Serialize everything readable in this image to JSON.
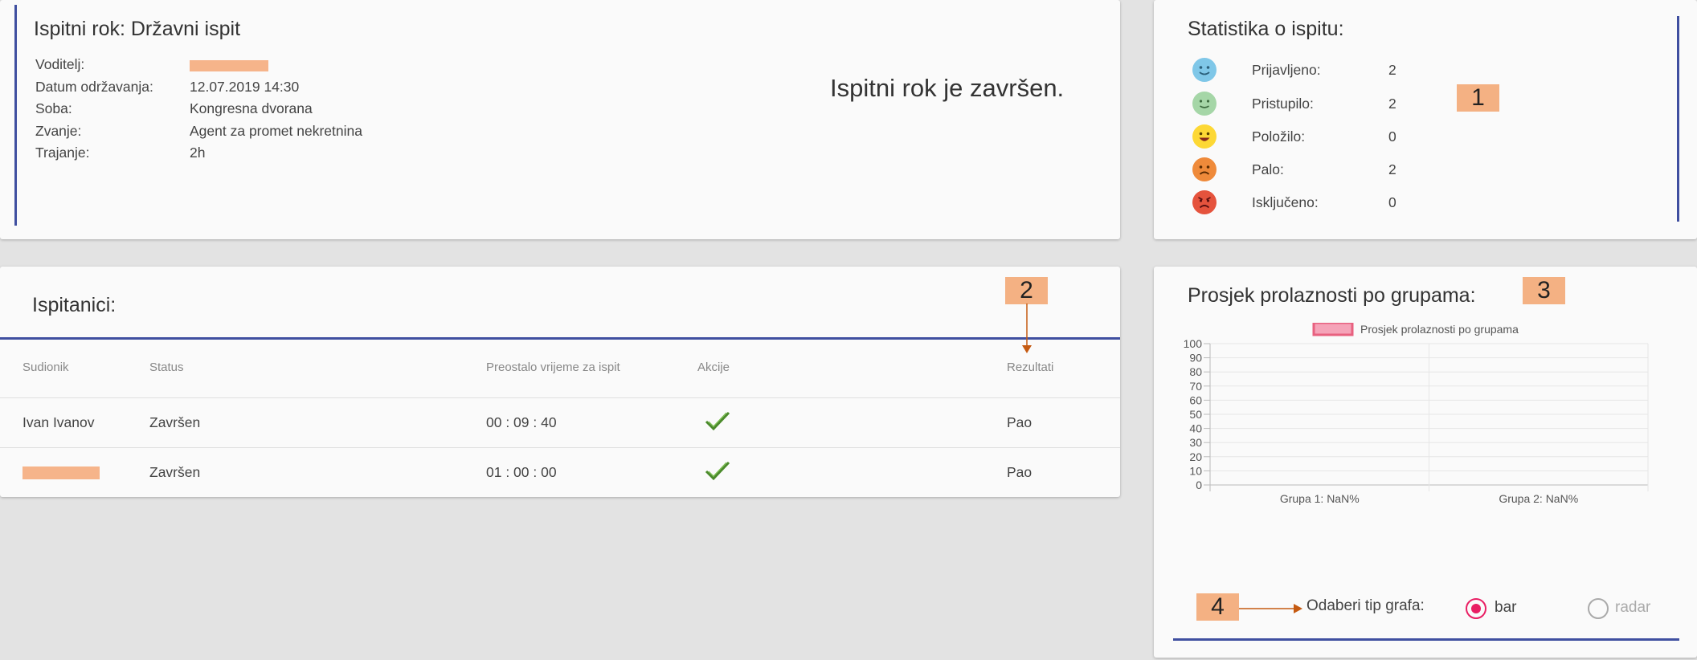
{
  "exam": {
    "title": "Ispitni rok: Državni ispit",
    "status_message": "Ispitni rok je završen.",
    "fields": [
      {
        "label": "Voditelj:",
        "value": ""
      },
      {
        "label": "Datum održavanja:",
        "value": "12.07.2019 14:30"
      },
      {
        "label": "Soba:",
        "value": "Kongresna dvorana"
      },
      {
        "label": "Zvanje:",
        "value": "Agent za promet nekretnina"
      },
      {
        "label": "Trajanje:",
        "value": "2h"
      }
    ]
  },
  "stats": {
    "title": "Statistika o ispitu:",
    "items": [
      {
        "label": "Prijavljeno:",
        "value": "2",
        "icon": "smile-blue-icon",
        "color": "#7fc7e8"
      },
      {
        "label": "Pristupilo:",
        "value": "2",
        "icon": "smile-green-icon",
        "color": "#a5d6a7"
      },
      {
        "label": "Položilo:",
        "value": "0",
        "icon": "grin-yellow-icon",
        "color": "#fdd835"
      },
      {
        "label": "Palo:",
        "value": "2",
        "icon": "frown-orange-icon",
        "color": "#ef8a3a"
      },
      {
        "label": "Isključeno:",
        "value": "0",
        "icon": "angry-red-icon",
        "color": "#e5533d"
      }
    ]
  },
  "students": {
    "title": "Ispitanici:",
    "columns": [
      "Sudionik",
      "Status",
      "Preostalo vrijeme za ispit",
      "Akcije",
      "Rezultati"
    ],
    "rows": [
      {
        "name": "Ivan Ivanov",
        "status": "Završen",
        "time": "00 : 09 : 40",
        "result": "Pao"
      },
      {
        "name": "",
        "status": "Završen",
        "time": "01 : 00 : 00",
        "result": "Pao"
      }
    ]
  },
  "chart_section": {
    "title": "Prosjek prolaznosti po grupama:",
    "type_label": "Odaberi tip grafa:",
    "options": [
      {
        "label": "bar",
        "selected": true
      },
      {
        "label": "radar",
        "selected": false
      }
    ]
  },
  "chart_data": {
    "type": "bar",
    "legend": "Prosjek prolaznosti po grupama",
    "categories": [
      "Grupa 1: NaN%",
      "Grupa 2: NaN%"
    ],
    "series": [
      {
        "name": "Prosjek prolaznosti po grupama",
        "values": [
          0,
          0
        ]
      }
    ],
    "ylim": [
      0,
      100
    ],
    "yticks": [
      0,
      10,
      20,
      30,
      40,
      50,
      60,
      70,
      80,
      90,
      100
    ],
    "grid": true,
    "legend_position": "top",
    "colors": {
      "fill": "#f5a3b8",
      "border": "#e8607f"
    }
  },
  "annotations": [
    "1",
    "2",
    "3",
    "4"
  ],
  "colors": {
    "accent": "#3f4fa0",
    "marker": "#f4b183",
    "radio": "#e91e63",
    "check": "#4a8a2a",
    "redact": "#f6b48a"
  }
}
